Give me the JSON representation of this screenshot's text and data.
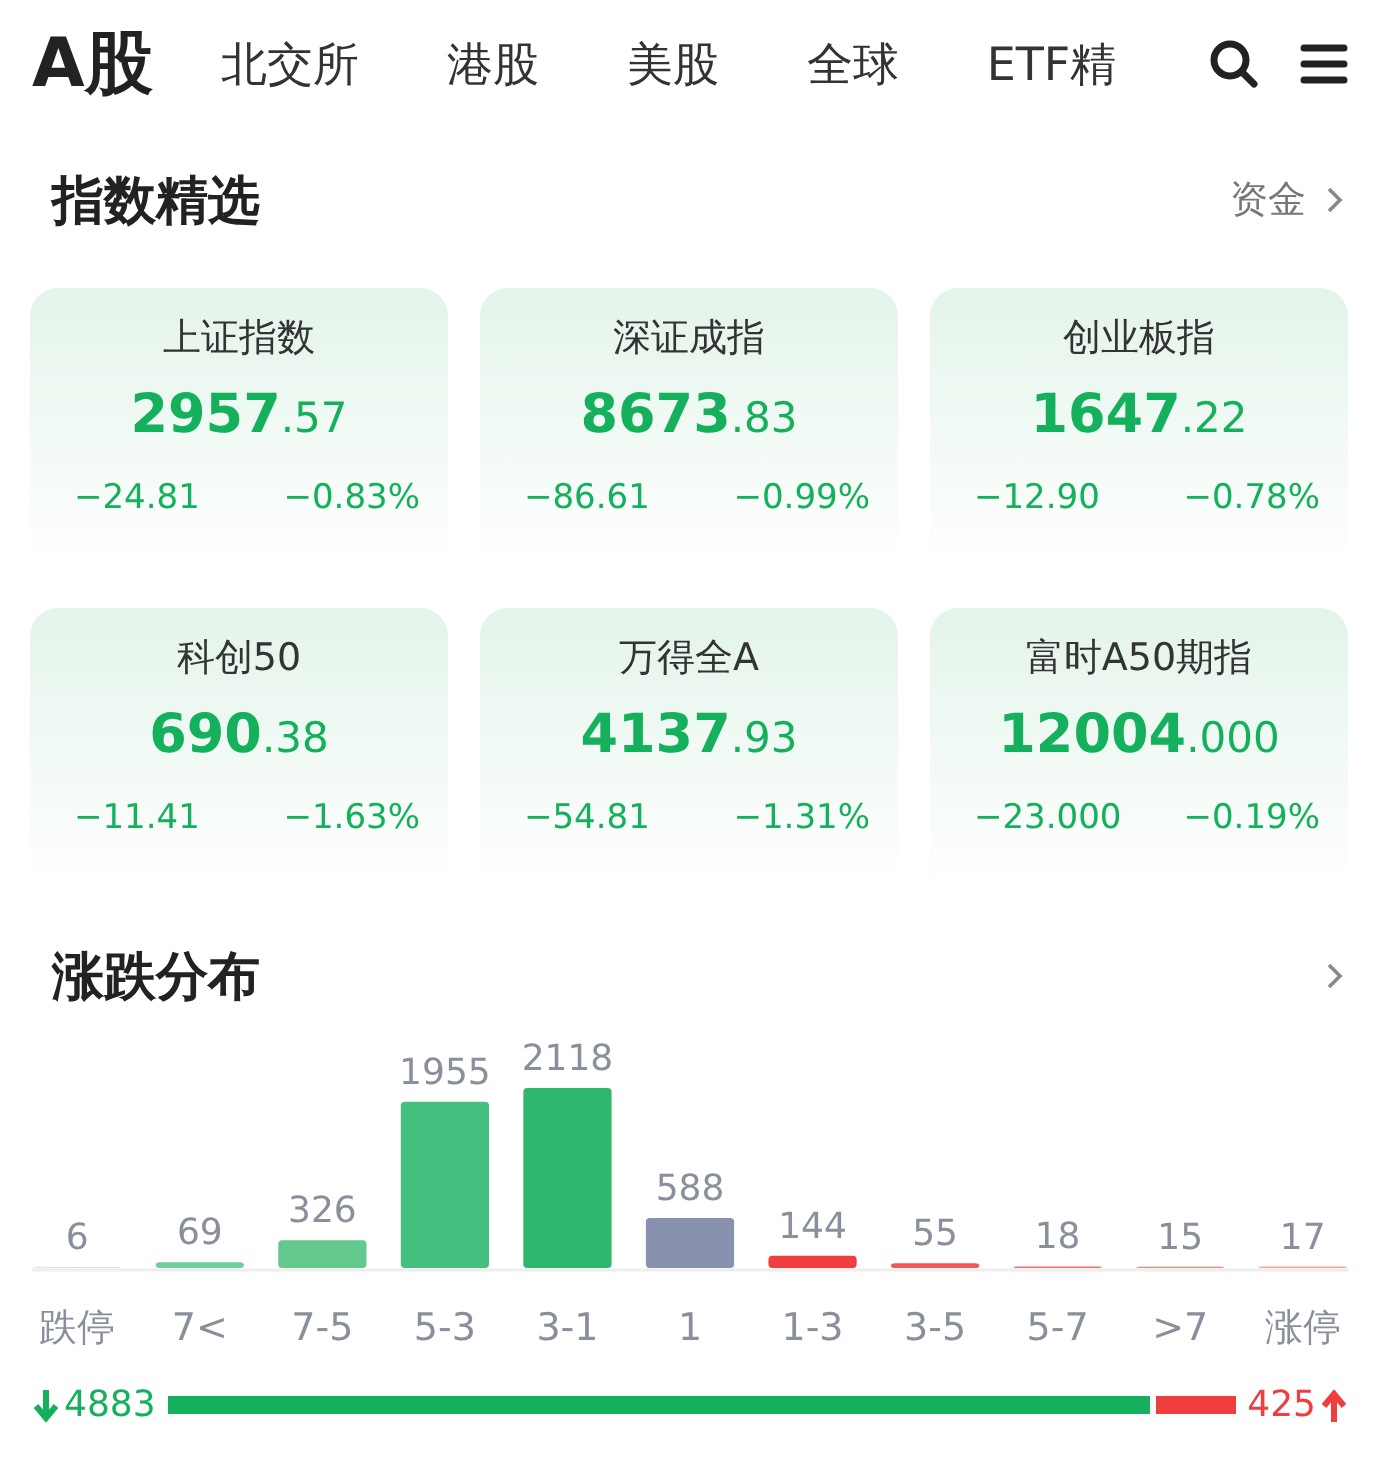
{
  "top_tabs": [
    {
      "label": "A股",
      "selected": true
    },
    {
      "label": "北交所",
      "selected": false
    },
    {
      "label": "港股",
      "selected": false
    },
    {
      "label": "美股",
      "selected": false
    },
    {
      "label": "全球",
      "selected": false
    },
    {
      "label": "ETF精",
      "selected": false
    }
  ],
  "index_section": {
    "title": "指数精选",
    "link": "资金",
    "cards": [
      {
        "name": "上证指数",
        "int": "2957",
        "frac": ".57",
        "change": "−24.81",
        "pct": "−0.83%"
      },
      {
        "name": "深证成指",
        "int": "8673",
        "frac": ".83",
        "change": "−86.61",
        "pct": "−0.99%"
      },
      {
        "name": "创业板指",
        "int": "1647",
        "frac": ".22",
        "change": "−12.90",
        "pct": "−0.78%"
      },
      {
        "name": "科创50",
        "int": "690",
        "frac": ".38",
        "change": "−11.41",
        "pct": "−1.63%"
      },
      {
        "name": "万得全A",
        "int": "4137",
        "frac": ".93",
        "change": "−54.81",
        "pct": "−1.31%"
      },
      {
        "name": "富时A50期指",
        "int": "12004",
        "frac": ".000",
        "change": "−23.000",
        "pct": "−0.19%"
      }
    ]
  },
  "distribution": {
    "title": "涨跌分布",
    "chart_data": {
      "type": "bar",
      "categories": [
        "跌停",
        "7<",
        "7-5",
        "5-3",
        "3-1",
        "1",
        "1-3",
        "3-5",
        "5-7",
        ">7",
        "涨停"
      ],
      "series": [
        {
          "values": [
            6,
            69,
            326,
            1955,
            2118,
            588,
            144,
            55,
            18,
            15,
            17
          ]
        }
      ],
      "data_labels": true
    },
    "down_total": "4883",
    "up_total": "425"
  }
}
